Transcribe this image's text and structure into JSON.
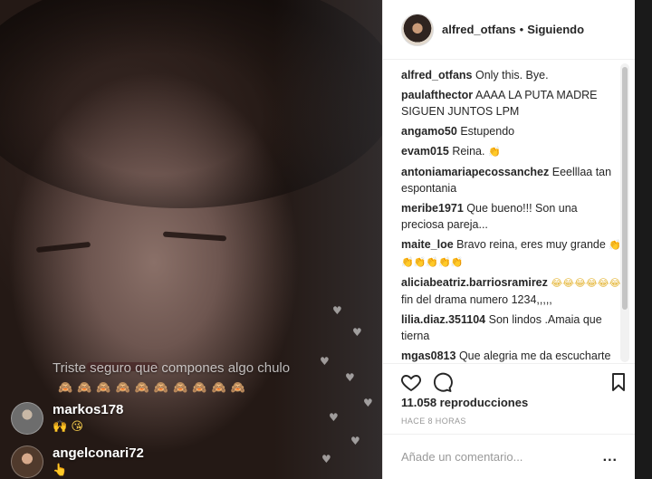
{
  "video": {
    "live_comment": "Triste seguro que compones algo chulo",
    "live_comment_emojis": "🙈🙈🙈🙈🙈🙈🙈🙈🙈🙈",
    "viewers": [
      {
        "name": "markos178",
        "emoji": "🙌 😘"
      },
      {
        "name": "angelconari72",
        "emoji": "👆"
      }
    ]
  },
  "post": {
    "username": "alfred_otfans",
    "separator": "•",
    "follow_label": "Siguiendo",
    "comments": [
      {
        "user": "alfred_otfans",
        "text": "Only this. Bye.",
        "emoji": ""
      },
      {
        "user": "paulafthector",
        "text": "AAAA LA PUTA MADRE SIGUEN JUNTOS LPM",
        "emoji": ""
      },
      {
        "user": "angamo50",
        "text": "Estupendo",
        "emoji": ""
      },
      {
        "user": "evam015",
        "text": "Reina.",
        "emoji": "👏"
      },
      {
        "user": "antoniamariapecossanchez",
        "text": "Eeelllaa tan espontania",
        "emoji": ""
      },
      {
        "user": "meribe1971",
        "text": "Que bueno!!! Son una preciosa pareja...",
        "emoji": ""
      },
      {
        "user": "maite_loe",
        "text": "Bravo reina, eres muy grande",
        "emoji": "👏👏👏👏👏👏"
      },
      {
        "user": "aliciabeatriz.barriosramirez",
        "text": "fin del drama numero 1234,,,,,",
        "emoji": "😂😂😂😂😂😂"
      },
      {
        "user": "lilia.diaz.351104",
        "text": "Son lindos .Amaia que tierna",
        "emoji": ""
      },
      {
        "user": "mgas0813",
        "text": "Que alegria me da escucharte de que sigues con Alfred. Teníamos aplastados el corazón por la",
        "emoji": ""
      }
    ],
    "views": "11.058 reproducciones",
    "time_ago": "HACE 8 HORAS",
    "add_comment_placeholder": "Añade un comentario...",
    "more_label": "..."
  }
}
